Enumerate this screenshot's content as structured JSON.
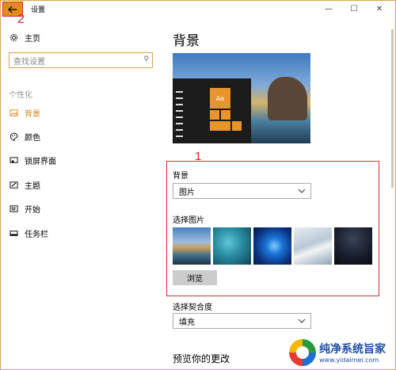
{
  "window": {
    "title": "设置",
    "controls": {
      "minimize": "—",
      "maximize": "☐",
      "close": "✕"
    }
  },
  "annotations": {
    "back": "2",
    "frame": "1"
  },
  "sidebar": {
    "home_label": "主页",
    "search_placeholder": "查找设置",
    "section": "个性化",
    "items": [
      {
        "label": "背景",
        "icon": "image-icon",
        "active": true
      },
      {
        "label": "颜色",
        "icon": "palette-icon"
      },
      {
        "label": "锁屏界面",
        "icon": "lockscreen-icon"
      },
      {
        "label": "主题",
        "icon": "theme-icon"
      },
      {
        "label": "开始",
        "icon": "start-icon"
      },
      {
        "label": "任务栏",
        "icon": "taskbar-icon"
      }
    ]
  },
  "main": {
    "title": "背景",
    "preview_tile_text": "Aa",
    "background_label": "背景",
    "background_value": "图片",
    "choose_picture_label": "选择图片",
    "browse_label": "浏览",
    "fit_label": "选择契合度",
    "fit_value": "填充",
    "preview_heading": "预览你的更改"
  },
  "watermark": {
    "name": "纯净系统旨家",
    "url": "www.yidaimei.com"
  },
  "colors": {
    "accent": "#d97f15",
    "frame_red": "#d32f2f"
  }
}
